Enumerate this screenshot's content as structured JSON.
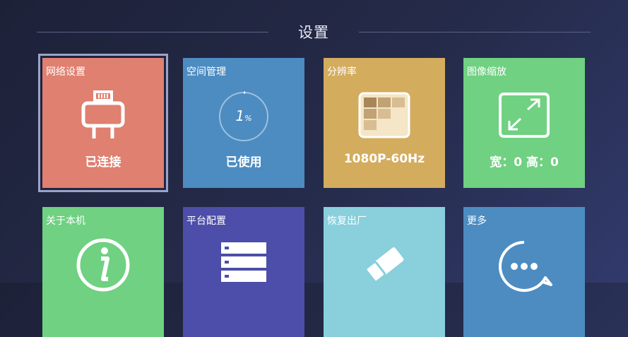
{
  "header": {
    "title": "设置"
  },
  "tiles": [
    {
      "label": "网络设置",
      "status": "已连接",
      "icon": "ethernet-icon",
      "color": "#df8070"
    },
    {
      "label": "空间管理",
      "status": "已使用",
      "icon": "storage-gauge-icon",
      "color": "#4d8cc1",
      "usage_value": "1",
      "usage_unit": "%",
      "usage_percent": 1
    },
    {
      "label": "分辨率",
      "status": "1080P-60Hz",
      "icon": "resolution-grid-icon",
      "color": "#d4ac5e"
    },
    {
      "label": "图像缩放",
      "status": "宽：0 高：0",
      "icon": "expand-icon",
      "color": "#6fd181"
    },
    {
      "label": "关于本机",
      "status": "",
      "icon": "info-icon",
      "color": "#6fd181"
    },
    {
      "label": "平台配置",
      "status": "",
      "icon": "server-icon",
      "color": "#4c4ea9"
    },
    {
      "label": "恢复出厂",
      "status": "",
      "icon": "eraser-icon",
      "color": "#89cfdc"
    },
    {
      "label": "更多",
      "status": "",
      "icon": "more-chat-icon",
      "color": "#4d8cc1"
    }
  ]
}
